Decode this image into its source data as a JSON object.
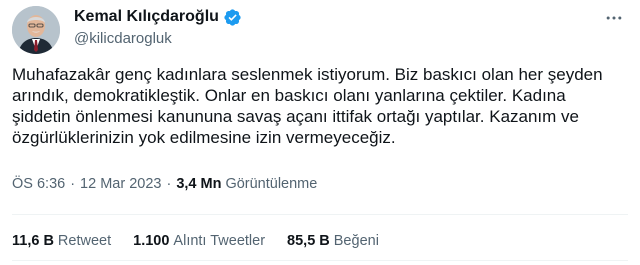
{
  "author": {
    "display_name": "Kemal Kılıçdaroğlu",
    "handle": "@kilicdarogluk",
    "verified_color": "#1d9bf0"
  },
  "tweet": {
    "text": "Muhafazakâr genç kadınlara seslenmek istiyorum. Biz baskıcı olan her şeyden arındık, demokratikleştik. Onlar en baskıcı olanı yanlarına çektiler. Kadına şiddetin önlenmesi kanununa savaş açanı ittifak ortağı yaptılar. Kazanım ve özgürlüklerinizin yok edilmesine izin vermeyeceğiz.",
    "time": "ÖS 6:36",
    "date": "12 Mar 2023",
    "views_count": "3,4 Mn",
    "views_label": "Görüntülenme"
  },
  "stats": {
    "retweets_count": "11,6 B",
    "retweets_label": "Retweet",
    "quotes_count": "1.100",
    "quotes_label": "Alıntı Tweetler",
    "likes_count": "85,5 B",
    "likes_label": "Beğeni"
  },
  "icons": {
    "verified": "verified-badge-icon",
    "more": "more-horizontal-icon"
  }
}
